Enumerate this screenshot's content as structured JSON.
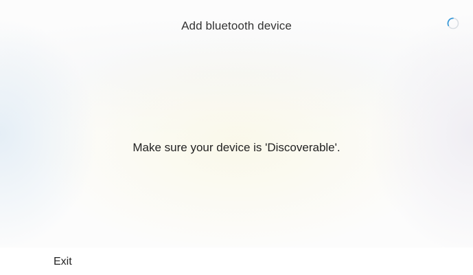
{
  "header": {
    "title": "Add bluetooth device",
    "spinner_icon": "loading-spinner-icon",
    "spinner_color": "#3a9ad9"
  },
  "main": {
    "message": "Make sure your device is 'Discoverable'."
  },
  "footer": {
    "exit_label": "Exit"
  }
}
